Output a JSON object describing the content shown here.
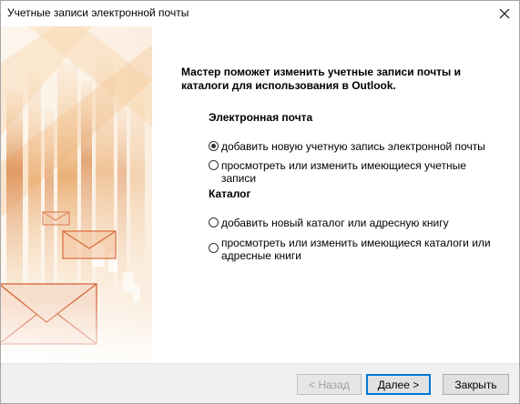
{
  "window": {
    "title": "Учетные записи электронной почты",
    "close_icon": "close-icon"
  },
  "main": {
    "intro": "Мастер поможет изменить учетные записи почты и каталоги для использования в Outlook.",
    "email_section": {
      "heading": "Электронная почта",
      "options": [
        {
          "label": "добавить новую учетную запись электронной почты",
          "selected": true
        },
        {
          "label": "просмотреть или изменить имеющиеся учетные записи",
          "selected": false
        }
      ]
    },
    "directory_section": {
      "heading": "Каталог",
      "options": [
        {
          "label": "добавить новый каталог или адресную книгу",
          "selected": false
        },
        {
          "label": "просмотреть или изменить имеющиеся каталоги или адресные книги",
          "selected": false
        }
      ]
    }
  },
  "footer": {
    "back_label": "< Назад",
    "next_label": "Далее >",
    "close_label": "Закрыть"
  },
  "colors": {
    "accent": "#0078d7",
    "art_orange": "#e8a86a"
  }
}
